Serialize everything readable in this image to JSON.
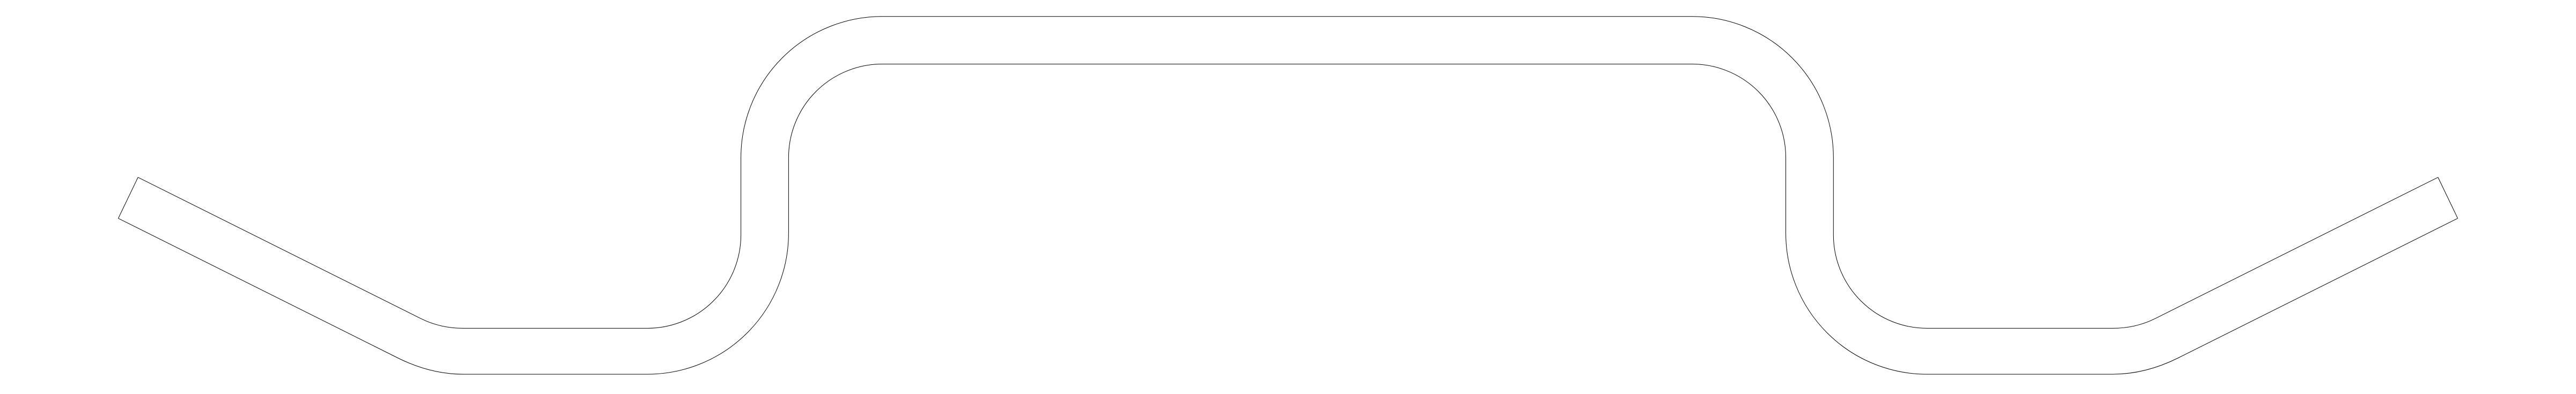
{
  "drawing": {
    "subject": "bent-bracket-profile",
    "stroke_color": "#000000",
    "background_color": "#ffffff",
    "fill_color": "none"
  }
}
